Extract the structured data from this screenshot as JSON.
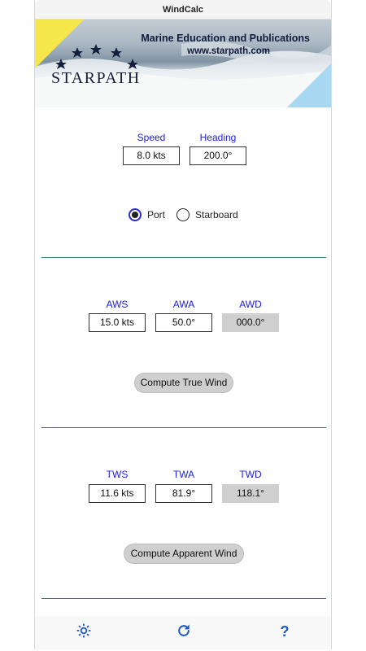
{
  "window": {
    "title": "WindCalc"
  },
  "banner": {
    "line1": "Marine Education and Publications",
    "line2": "www.starpath.com",
    "brand": "STARPATH"
  },
  "boat": {
    "speed_label": "Speed",
    "speed_value": "8.0 kts",
    "heading_label": "Heading",
    "heading_value": "200.0°"
  },
  "tack": {
    "port_label": "Port",
    "starboard_label": "Starboard",
    "selected": "Port"
  },
  "apparent": {
    "aws_label": "AWS",
    "aws_value": "15.0 kts",
    "awa_label": "AWA",
    "awa_value": "50.0°",
    "awd_label": "AWD",
    "awd_value": "000.0°",
    "button_label": "Compute True Wind"
  },
  "true_wind": {
    "tws_label": "TWS",
    "tws_value": "11.6 kts",
    "twa_label": "TWA",
    "twa_value": "81.9°",
    "twd_label": "TWD",
    "twd_value": "118.1°",
    "button_label": "Compute Apparent Wind"
  },
  "toolbar": {
    "settings_icon": "gear-icon",
    "refresh_icon": "refresh-icon",
    "help_glyph": "?"
  },
  "colors": {
    "label_blue": "#2020e0",
    "divider_teal": "#2f7a7a",
    "icon_blue": "#1f58c8",
    "readonly_gray": "#cfcfcf"
  }
}
